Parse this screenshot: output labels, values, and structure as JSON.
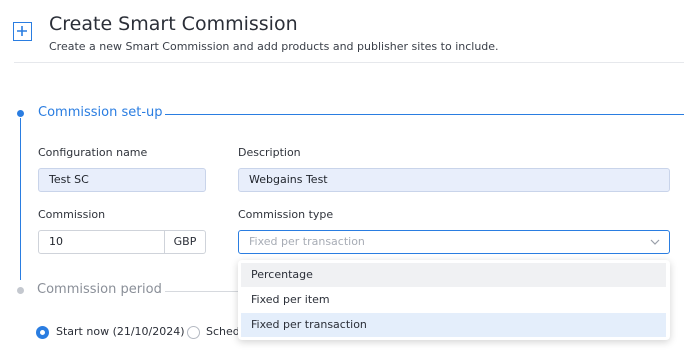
{
  "header": {
    "title": "Create Smart Commission",
    "subtitle": "Create a new Smart Commission and add products and publisher sites to include.",
    "icon": "add-square-icon"
  },
  "steps": [
    {
      "label": "Commission set-up",
      "state": "active",
      "color": "#2a7de1"
    },
    {
      "label": "Commission period",
      "state": "inactive",
      "color": "#8a8f98"
    }
  ],
  "form": {
    "configuration_name": {
      "label": "Configuration name",
      "value": "Test SC"
    },
    "description": {
      "label": "Description",
      "value": "Webgains Test"
    },
    "commission": {
      "label": "Commission",
      "value": "10",
      "currency": "GBP"
    },
    "commission_type": {
      "label": "Commission type",
      "placeholder": "Fixed per transaction",
      "options": [
        "Percentage",
        "Fixed per item",
        "Fixed per transaction"
      ],
      "selected": "Fixed per transaction",
      "hovered": "Percentage"
    }
  },
  "period": {
    "options": [
      {
        "label": "Start now (21/10/2024)",
        "checked": true
      },
      {
        "label": "Sched",
        "checked": false
      }
    ]
  },
  "colors": {
    "accent": "#2a7de1",
    "field_fill": "#e8eefb"
  }
}
